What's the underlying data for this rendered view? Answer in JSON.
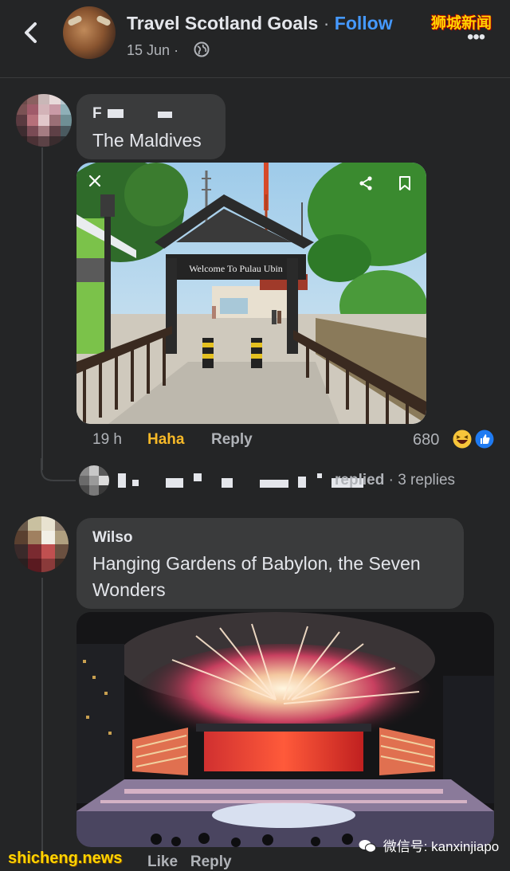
{
  "header": {
    "page_name": "Travel Scotland Goals",
    "separator": "·",
    "follow_label": "Follow",
    "date": "15 Jun",
    "date_separator": "·",
    "watermark": "狮城新闻",
    "more_icon": "more-dots-icon"
  },
  "comments": [
    {
      "author": "F",
      "text": "The Maldives",
      "photo_sign": "Welcome To Pulau Ubin",
      "time": "19 h",
      "reaction_label": "Haha",
      "reply_label": "Reply",
      "reaction_count": "680",
      "reactions": [
        "haha-emoji-icon",
        "like-icon"
      ]
    },
    {
      "author": "Wilso",
      "text": "Hanging Gardens of Babylon, the Seven Wonders"
    }
  ],
  "replies_row": {
    "text_fragment": "replied",
    "count_text": "· 3 replies"
  },
  "footer": {
    "watermark_site": "shicheng.news",
    "wechat_id": "微信号: kanxinjiapo",
    "partial_actions": "Like   Reply"
  },
  "colors": {
    "background": "#242526",
    "bubble": "#3a3b3c",
    "follow_blue": "#4599ff",
    "haha_yellow": "#f7b928",
    "secondary_text": "#b0b3b8"
  }
}
